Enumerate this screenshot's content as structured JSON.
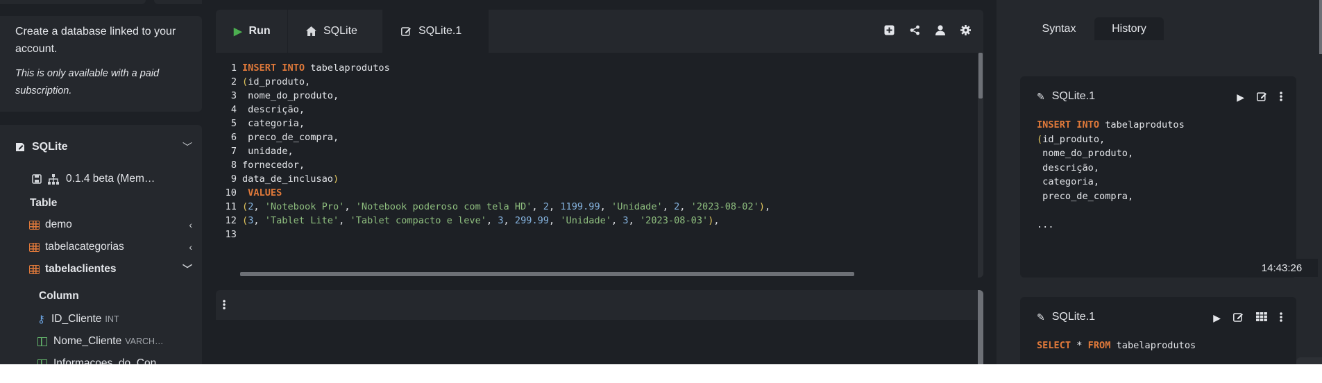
{
  "upsell": {
    "line1": "Create a database linked to your account.",
    "line2": "This is only available with a paid subscription."
  },
  "db": {
    "name": "SQLite",
    "version": "0.1.4 beta (Mem…",
    "table_heading": "Table",
    "tables": [
      {
        "name": "demo"
      },
      {
        "name": "tabelacategorias"
      },
      {
        "name": "tabelaclientes"
      }
    ],
    "column_heading": "Column",
    "columns": [
      {
        "name": "ID_Cliente",
        "type": "INT"
      },
      {
        "name": "Nome_Cliente",
        "type": "VARCH…"
      },
      {
        "name": "Informacoes_do_Con…",
        "type": ""
      }
    ]
  },
  "editor": {
    "run_label": "Run",
    "tab_home": "SQLite",
    "tab_active": "SQLite.1",
    "lines": [
      {
        "n": "1",
        "parts": [
          [
            "kw",
            "INSERT INTO"
          ],
          [
            "txt",
            " tabelaprodutos"
          ]
        ]
      },
      {
        "n": "2",
        "parts": [
          [
            "par",
            "("
          ],
          [
            "txt",
            "id_produto,"
          ]
        ]
      },
      {
        "n": "3",
        "parts": [
          [
            "txt",
            " nome_do_produto,"
          ]
        ]
      },
      {
        "n": "4",
        "parts": [
          [
            "txt",
            " descrição,"
          ]
        ]
      },
      {
        "n": "5",
        "parts": [
          [
            "txt",
            " categoria,"
          ]
        ]
      },
      {
        "n": "6",
        "parts": [
          [
            "txt",
            " preco_de_compra,"
          ]
        ]
      },
      {
        "n": "7",
        "parts": [
          [
            "txt",
            " unidade,"
          ]
        ]
      },
      {
        "n": "8",
        "parts": [
          [
            "txt",
            "fornecedor,"
          ]
        ]
      },
      {
        "n": "9",
        "parts": [
          [
            "txt",
            "data_de_inclusao"
          ],
          [
            "par",
            ")"
          ]
        ]
      },
      {
        "n": "10",
        "parts": [
          [
            "kw",
            " VALUES"
          ]
        ]
      },
      {
        "n": "11",
        "parts": [
          [
            "par",
            "("
          ],
          [
            "num",
            "2"
          ],
          [
            "txt",
            ", "
          ],
          [
            "str",
            "'Notebook Pro'"
          ],
          [
            "txt",
            ", "
          ],
          [
            "str",
            "'Notebook poderoso com tela HD'"
          ],
          [
            "txt",
            ", "
          ],
          [
            "num",
            "2"
          ],
          [
            "txt",
            ", "
          ],
          [
            "num",
            "1199.99"
          ],
          [
            "txt",
            ", "
          ],
          [
            "str",
            "'Unidade'"
          ],
          [
            "txt",
            ", "
          ],
          [
            "num",
            "2"
          ],
          [
            "txt",
            ", "
          ],
          [
            "str",
            "'2023-08-02'"
          ],
          [
            "par",
            ")"
          ],
          [
            "txt",
            ","
          ]
        ]
      },
      {
        "n": "12",
        "parts": [
          [
            "par",
            "("
          ],
          [
            "num",
            "3"
          ],
          [
            "txt",
            ", "
          ],
          [
            "str",
            "'Tablet Lite'"
          ],
          [
            "txt",
            ", "
          ],
          [
            "str",
            "'Tablet compacto e leve'"
          ],
          [
            "txt",
            ", "
          ],
          [
            "num",
            "3"
          ],
          [
            "txt",
            ", "
          ],
          [
            "num",
            "299.99"
          ],
          [
            "txt",
            ", "
          ],
          [
            "str",
            "'Unidade'"
          ],
          [
            "txt",
            ", "
          ],
          [
            "num",
            "3"
          ],
          [
            "txt",
            ", "
          ],
          [
            "str",
            "'2023-08-03'"
          ],
          [
            "par",
            ")"
          ],
          [
            "txt",
            ","
          ]
        ]
      },
      {
        "n": "13",
        "parts": [
          [
            "txt",
            ""
          ]
        ]
      }
    ]
  },
  "right": {
    "tab_syntax": "Syntax",
    "tab_history": "History",
    "history": [
      {
        "title": "SQLite.1",
        "lines": [
          [
            [
              "kw",
              "INSERT INTO"
            ],
            [
              "txt",
              " tabelaprodutos"
            ]
          ],
          [
            [
              "par",
              "("
            ],
            [
              "txt",
              "id_produto,"
            ]
          ],
          [
            [
              "txt",
              " nome_do_produto,"
            ]
          ],
          [
            [
              "txt",
              " descrição,"
            ]
          ],
          [
            [
              "txt",
              " categoria,"
            ]
          ],
          [
            [
              "txt",
              " preco_de_compra,"
            ]
          ],
          [
            [
              "txt",
              ""
            ]
          ],
          [
            [
              "txt",
              "..."
            ]
          ]
        ],
        "time": "14:43:26"
      },
      {
        "title": "SQLite.1",
        "lines": [
          [
            [
              "kw",
              "SELECT"
            ],
            [
              "txt",
              " * "
            ],
            [
              "kw",
              "FROM"
            ],
            [
              "txt",
              " tabelaprodutos"
            ]
          ]
        ]
      }
    ]
  },
  "colors": {
    "background": "#1d2025",
    "panel": "#25282d",
    "keyword": "#e0793a",
    "string": "#8fbf7f",
    "number": "#86b4e0",
    "paren": "#e2c65d",
    "run_icon": "#4caf50",
    "table_icon": "#e0793a",
    "key_icon": "#6ea8e8",
    "column_icon": "#63b26b"
  },
  "icons": {
    "run": "play-icon",
    "home": "home-icon",
    "edit": "edit-icon",
    "toolbar": [
      "add-square-icon",
      "share-icon",
      "user-icon",
      "gear-icon"
    ],
    "history_actions_1": [
      "play-icon",
      "edit-icon",
      "more-vertical-icon"
    ],
    "history_actions_2": [
      "play-icon",
      "edit-icon",
      "grid-icon",
      "more-vertical-icon"
    ]
  }
}
